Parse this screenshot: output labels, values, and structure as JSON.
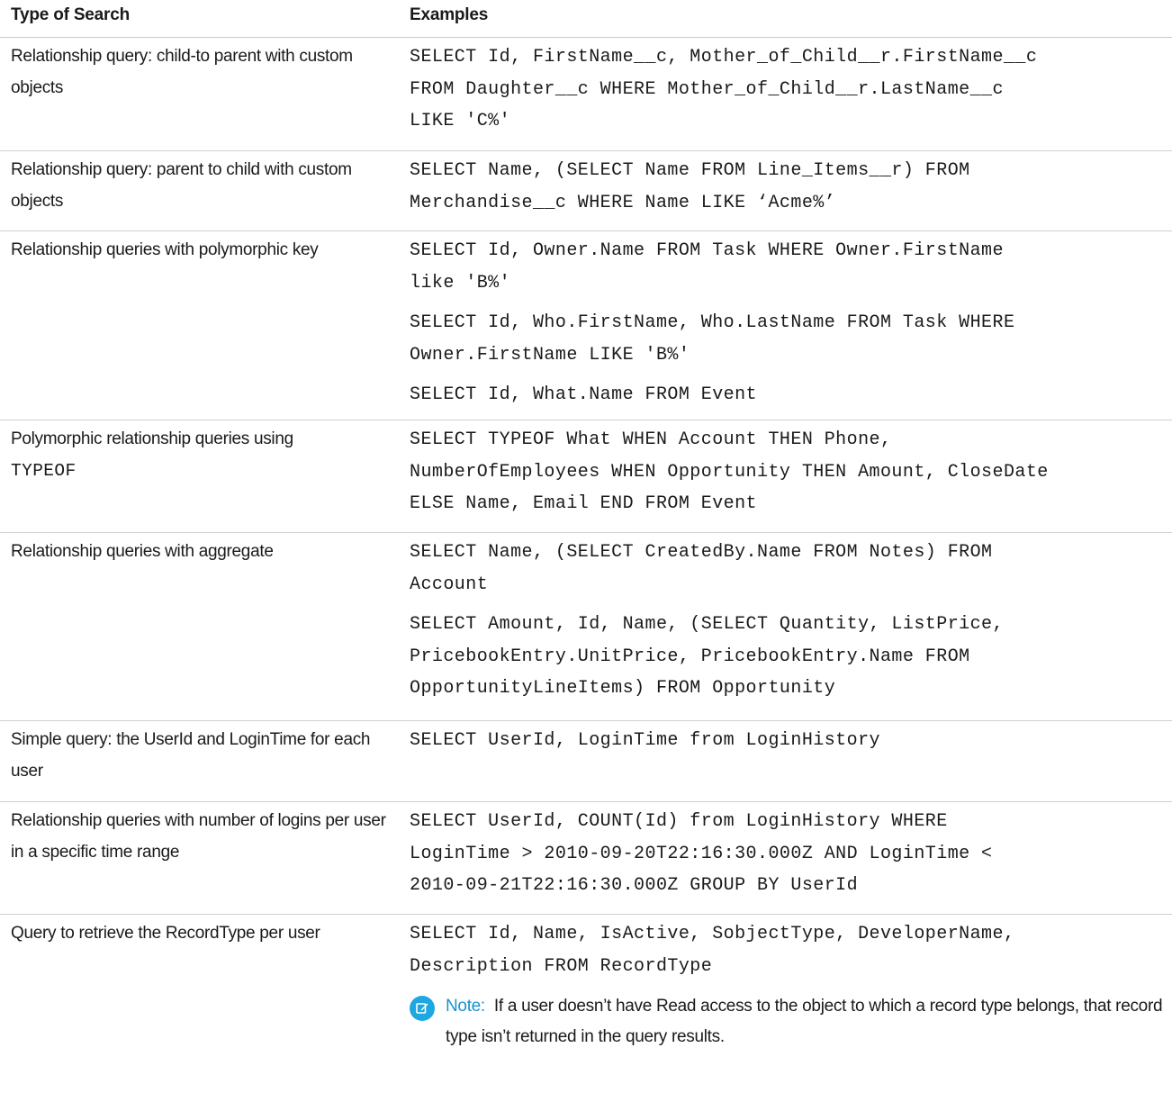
{
  "table": {
    "headers": {
      "type": "Type of Search",
      "examples": "Examples"
    },
    "rows": [
      {
        "type": "Relationship query: child-to parent with custom objects",
        "examples": [
          "SELECT Id, FirstName__c, Mother_of_Child__r.FirstName__c\nFROM Daughter__c WHERE Mother_of_Child__r.LastName__c\nLIKE 'C%'"
        ]
      },
      {
        "type": "Relationship query: parent to child with custom objects",
        "examples": [
          "SELECT Name, (SELECT Name FROM Line_Items__r) FROM\nMerchandise__c WHERE Name LIKE ‘Acme%’"
        ]
      },
      {
        "type": "Relationship queries with polymorphic key",
        "examples": [
          "SELECT Id, Owner.Name FROM Task WHERE Owner.FirstName\nlike 'B%'",
          "SELECT Id, Who.FirstName, Who.LastName FROM Task WHERE\nOwner.FirstName LIKE 'B%'",
          "SELECT Id, What.Name FROM Event"
        ]
      },
      {
        "type_prefix": "Polymorphic relationship queries using",
        "type_code": "TYPEOF",
        "examples": [
          "SELECT TYPEOF What WHEN Account THEN Phone,\nNumberOfEmployees WHEN Opportunity THEN Amount, CloseDate\nELSE Name, Email END FROM Event"
        ]
      },
      {
        "type": "Relationship queries with aggregate",
        "examples": [
          "SELECT Name, (SELECT CreatedBy.Name FROM Notes) FROM\nAccount",
          "SELECT Amount, Id, Name, (SELECT Quantity, ListPrice,\nPricebookEntry.UnitPrice, PricebookEntry.Name FROM\nOpportunityLineItems) FROM Opportunity"
        ]
      },
      {
        "type": "Simple query: the UserId and LoginTime for each user",
        "examples": [
          "SELECT UserId, LoginTime from LoginHistory"
        ]
      },
      {
        "type": "Relationship queries with number of logins per user in a specific time range",
        "examples": [
          "SELECT UserId, COUNT(Id) from LoginHistory WHERE\nLoginTime > 2010-09-20T22:16:30.000Z AND LoginTime <\n2010-09-21T22:16:30.000Z GROUP BY UserId"
        ]
      },
      {
        "type": "Query to retrieve the RecordType per user",
        "examples": [
          "SELECT Id, Name, IsActive, SobjectType, DeveloperName,\nDescription FROM RecordType"
        ]
      }
    ]
  },
  "note": {
    "icon": "edit-note-icon",
    "label": "Note:",
    "text": "If a user doesn’t have Read access to the object to which a record type belongs, that record type isn’t returned in the query results."
  },
  "colors": {
    "accent": "#1ea7e1",
    "note_label": "#1a93cf",
    "divider": "#d0d0d0"
  }
}
